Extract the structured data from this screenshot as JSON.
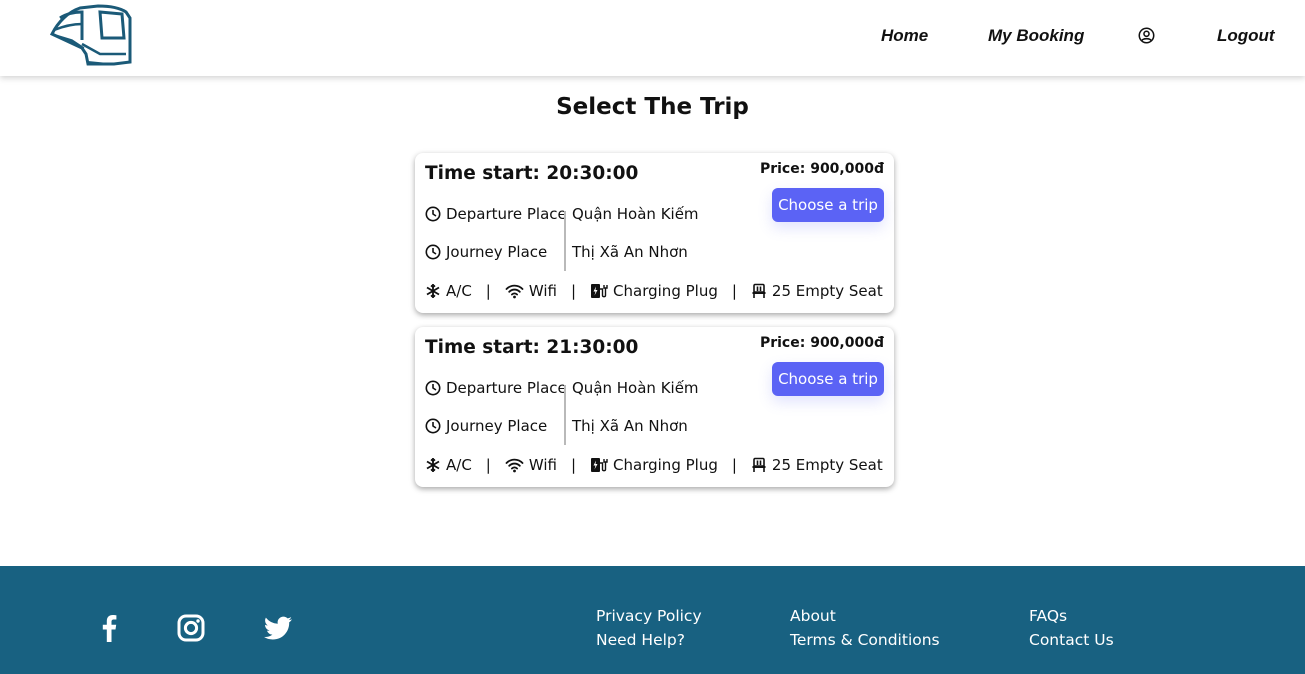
{
  "nav": {
    "home": "Home",
    "my_booking": "My Booking",
    "logout": "Logout",
    "user_icon": "user-circle-icon",
    "logo_icon": "bus-logo"
  },
  "page_title": "Select The Trip",
  "trips": [
    {
      "time_start": "Time start: 20:30:00",
      "price": "Price: 900,000đ",
      "choose_label": "Choose a trip",
      "departure_label": "Departure Place",
      "departure_value": "Quận Hoàn Kiếm",
      "journey_label": "Journey Place",
      "journey_value": "Thị Xã An Nhơn",
      "amenities": {
        "ac": "A/C",
        "wifi": "Wifi",
        "charging": "Charging Plug",
        "seats": "25 Empty Seat"
      }
    },
    {
      "time_start": "Time start: 21:30:00",
      "price": "Price: 900,000đ",
      "choose_label": "Choose a trip",
      "departure_label": "Departure Place",
      "departure_value": "Quận Hoàn Kiếm",
      "journey_label": "Journey Place",
      "journey_value": "Thị Xã An Nhơn",
      "amenities": {
        "ac": "A/C",
        "wifi": "Wifi",
        "charging": "Charging Plug",
        "seats": "25 Empty Seat"
      }
    }
  ],
  "amenity_separator": "|",
  "footer": {
    "background": "#186181",
    "social": [
      "facebook-icon",
      "instagram-icon",
      "twitter-icon"
    ],
    "links": {
      "privacy": "Privacy Policy",
      "help": "Need Help?",
      "about": "About",
      "terms": "Terms & Conditions",
      "faqs": "FAQs",
      "contact": "Contact Us"
    }
  },
  "colors": {
    "accent_button": "#5b63f5",
    "footer": "#186181",
    "logo": "#1b5a78"
  }
}
